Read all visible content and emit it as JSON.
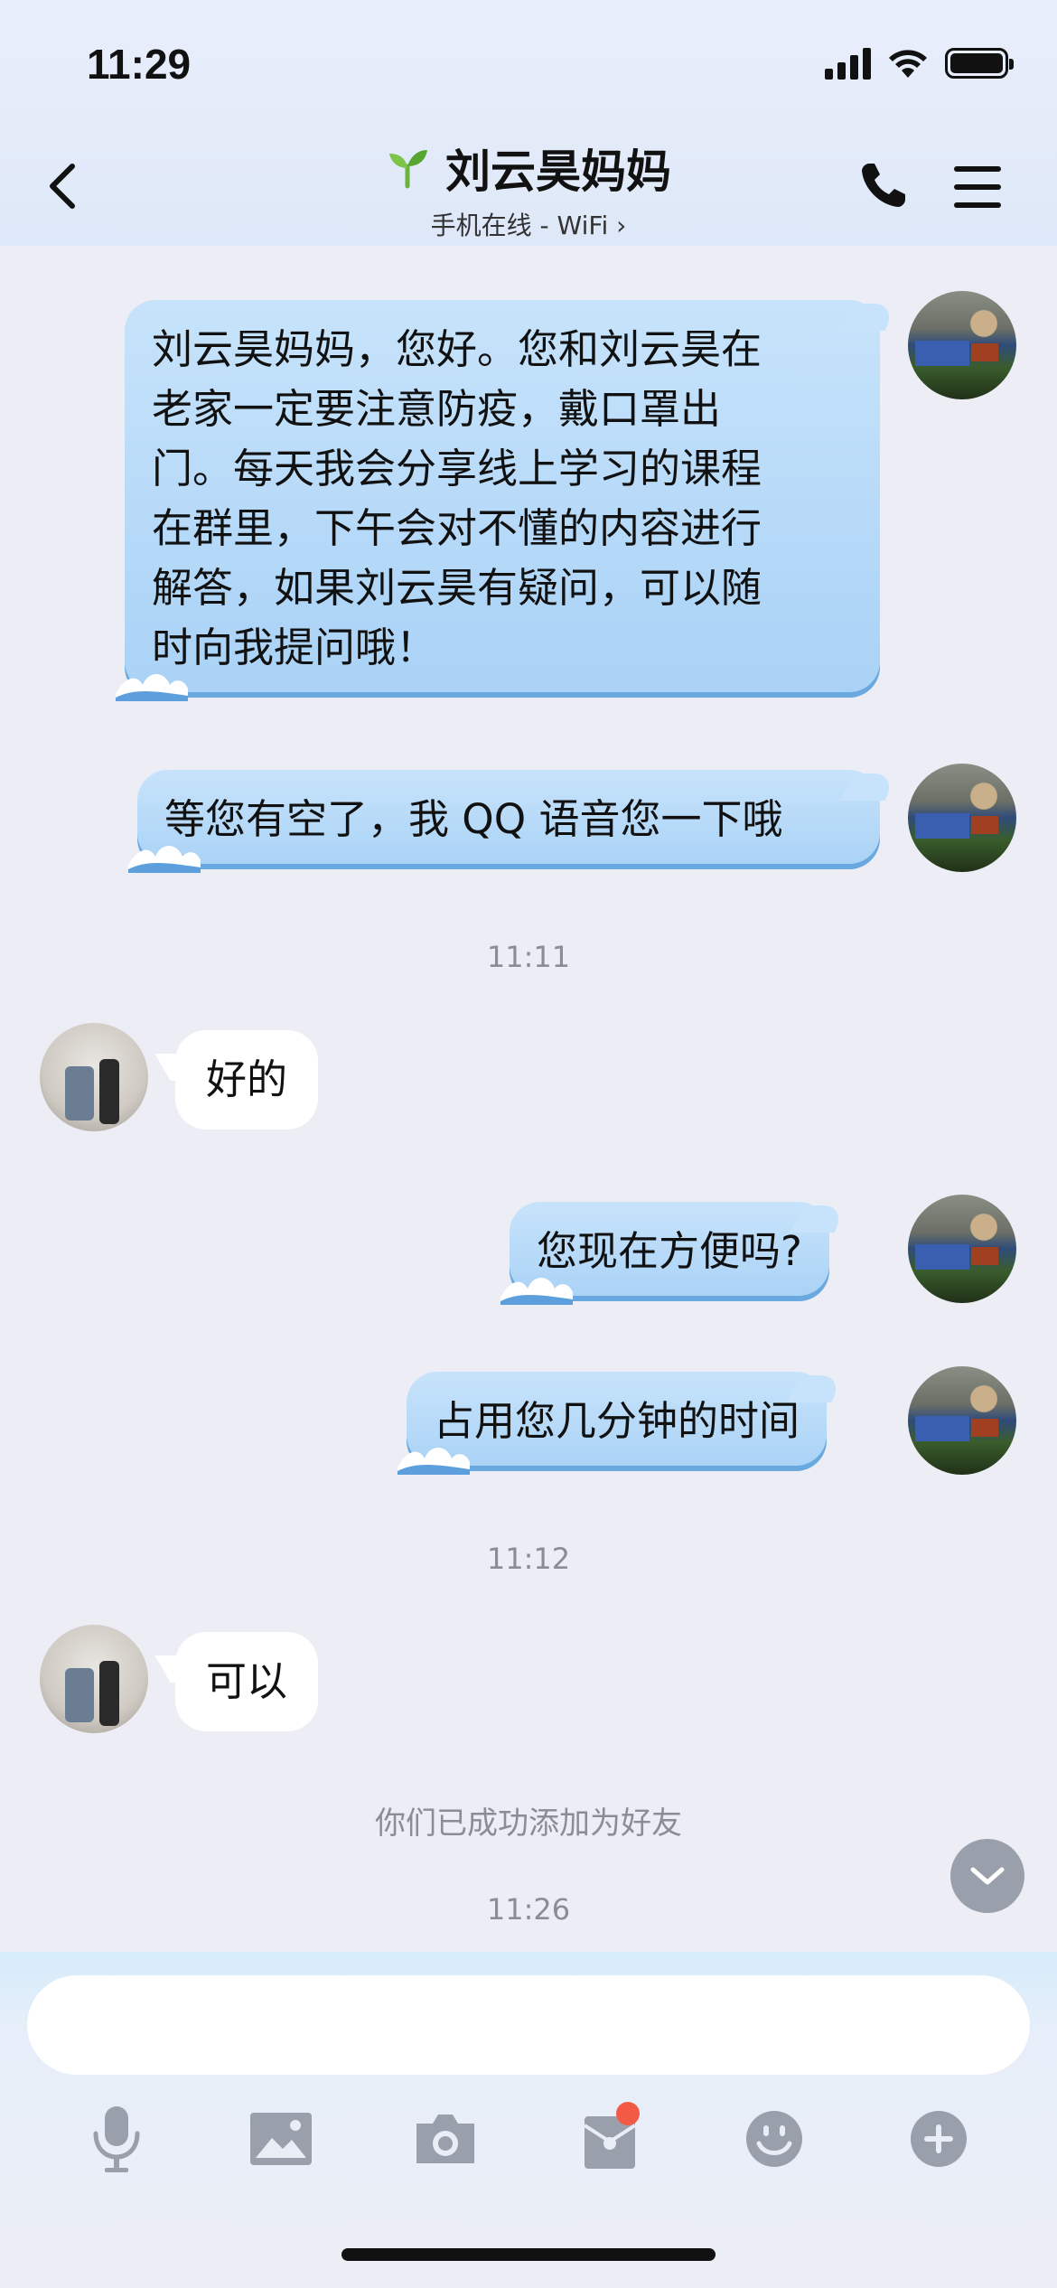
{
  "status_bar": {
    "time": "11:29"
  },
  "header": {
    "title": "刘云昊妈妈",
    "subtitle": "手机在线 - WiFi ›"
  },
  "messages": [
    {
      "sender": "me",
      "text_lines": [
        "刘云昊妈妈，您好。您和刘云昊在",
        "老家一定要注意防疫，戴口罩出",
        "门。每天我会分享线上学习的课程",
        "在群里，下午会对不懂的内容进行",
        "解答，如果刘云昊有疑问，可以随",
        "时向我提问哦！"
      ]
    },
    {
      "sender": "me",
      "text": "等您有空了，我 QQ 语音您一下哦"
    },
    {
      "type": "time",
      "text": "11:11"
    },
    {
      "sender": "them",
      "text": "好的"
    },
    {
      "sender": "me",
      "text": "您现在方便吗?"
    },
    {
      "sender": "me",
      "text": "占用您几分钟的时间"
    },
    {
      "type": "time",
      "text": "11:12"
    },
    {
      "sender": "them",
      "text": "可以"
    },
    {
      "type": "system",
      "text": "你们已成功添加为好友"
    },
    {
      "type": "time",
      "text": "11:26"
    }
  ],
  "input": {
    "placeholder": ""
  },
  "toolbar": {
    "icons": [
      "microphone-icon",
      "image-icon",
      "camera-icon",
      "red-packet-icon",
      "emoji-icon",
      "plus-icon"
    ],
    "badge_color": "#f25a45"
  },
  "colors": {
    "my_bubble": "#b8dbf8",
    "their_bubble": "#ffffff",
    "background": "#ecedf5"
  }
}
